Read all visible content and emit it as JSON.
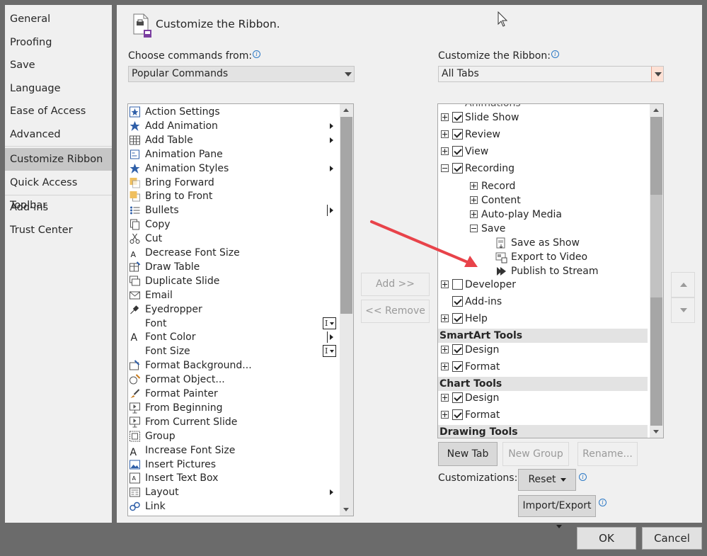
{
  "nav": {
    "items": [
      {
        "label": "General",
        "active": false
      },
      {
        "label": "Proofing",
        "active": false
      },
      {
        "label": "Save",
        "active": false
      },
      {
        "label": "Language",
        "active": false
      },
      {
        "label": "Ease of Access",
        "active": false
      },
      {
        "label": "Advanced",
        "active": false
      },
      {
        "label": "Customize Ribbon",
        "active": true
      },
      {
        "label": "Quick Access Toolbar",
        "active": false
      },
      {
        "label": "Add-ins",
        "active": false
      },
      {
        "label": "Trust Center",
        "active": false
      }
    ]
  },
  "header": {
    "title": "Customize the Ribbon."
  },
  "left_panel": {
    "label": "Choose commands from:",
    "combo_value": "Popular Commands",
    "commands": [
      {
        "label": "Action Settings",
        "icon": "action-settings-icon",
        "sub": false
      },
      {
        "label": "Add Animation",
        "icon": "star-icon",
        "sub": true
      },
      {
        "label": "Add Table",
        "icon": "table-icon",
        "sub": true
      },
      {
        "label": "Animation Pane",
        "icon": "animation-pane-icon",
        "sub": false
      },
      {
        "label": "Animation Styles",
        "icon": "star-icon",
        "sub": true
      },
      {
        "label": "Bring Forward",
        "icon": "bring-forward-icon",
        "sub": false
      },
      {
        "label": "Bring to Front",
        "icon": "bring-front-icon",
        "sub": false
      },
      {
        "label": "Bullets",
        "icon": "bullets-icon",
        "sub": "split"
      },
      {
        "label": "Copy",
        "icon": "copy-icon",
        "sub": false
      },
      {
        "label": "Cut",
        "icon": "scissors-icon",
        "sub": false
      },
      {
        "label": "Decrease Font Size",
        "icon": "decrease-font-icon",
        "sub": false
      },
      {
        "label": "Draw Table",
        "icon": "draw-table-icon",
        "sub": false
      },
      {
        "label": "Duplicate Slide",
        "icon": "duplicate-slide-icon",
        "sub": false
      },
      {
        "label": "Email",
        "icon": "email-icon",
        "sub": false
      },
      {
        "label": "Eyedropper",
        "icon": "eyedropper-icon",
        "sub": false
      },
      {
        "label": "Font",
        "icon": "",
        "sub": "combo"
      },
      {
        "label": "Font Color",
        "icon": "font-color-icon",
        "sub": "split"
      },
      {
        "label": "Font Size",
        "icon": "",
        "sub": "combo"
      },
      {
        "label": "Format Background...",
        "icon": "format-background-icon",
        "sub": false
      },
      {
        "label": "Format Object...",
        "icon": "format-object-icon",
        "sub": false
      },
      {
        "label": "Format Painter",
        "icon": "paintbrush-icon",
        "sub": false
      },
      {
        "label": "From Beginning",
        "icon": "from-beginning-icon",
        "sub": false
      },
      {
        "label": "From Current Slide",
        "icon": "from-current-icon",
        "sub": false
      },
      {
        "label": "Group",
        "icon": "group-icon",
        "sub": false
      },
      {
        "label": "Increase Font Size",
        "icon": "increase-font-icon",
        "sub": false
      },
      {
        "label": "Insert Pictures",
        "icon": "pictures-icon",
        "sub": false
      },
      {
        "label": "Insert Text Box",
        "icon": "textbox-icon",
        "sub": false
      },
      {
        "label": "Layout",
        "icon": "layout-icon",
        "sub": true
      },
      {
        "label": "Link",
        "icon": "link-icon",
        "sub": false
      }
    ]
  },
  "middle": {
    "add_label": "Add >>",
    "remove_label": "<< Remove"
  },
  "right_panel": {
    "label": "Customize the Ribbon:",
    "combo_value": "All Tabs",
    "tree": {
      "partial_top": "Animations",
      "slide_show": "Slide Show",
      "review": "Review",
      "view": "View",
      "recording": "Recording",
      "record": "Record",
      "content": "Content",
      "auto_play": "Auto-play Media",
      "save": "Save",
      "save_as_show": "Save as Show",
      "export_to_video": "Export to Video",
      "publish_to_stream": "Publish to Stream",
      "developer": "Developer",
      "add_ins": "Add-ins",
      "help": "Help",
      "smartart_tools": "SmartArt Tools",
      "smartart_design": "Design",
      "smartart_format": "Format",
      "chart_tools": "Chart Tools",
      "chart_design": "Design",
      "chart_format": "Format",
      "drawing_tools": "Drawing Tools"
    },
    "new_tab": "New Tab",
    "new_group": "New Group",
    "rename": "Rename...",
    "customizations_label": "Customizations:",
    "reset": "Reset",
    "import_export": "Import/Export"
  },
  "footer": {
    "ok": "OK",
    "cancel": "Cancel"
  },
  "colors": {
    "annotation_arrow": "#e8434a",
    "accent_blue": "#2b78c5"
  }
}
